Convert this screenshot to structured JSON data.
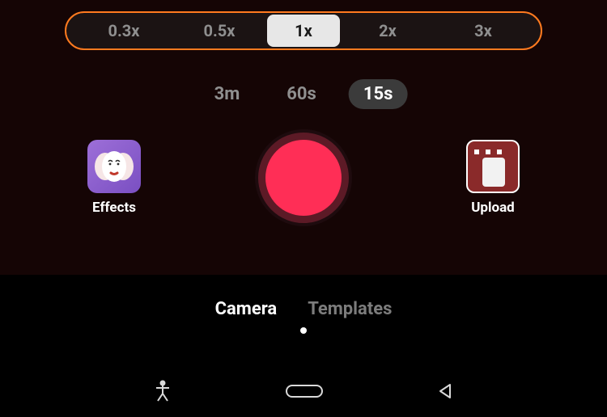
{
  "speed": {
    "options": [
      "0.3x",
      "0.5x",
      "1x",
      "2x",
      "3x"
    ],
    "activeIndex": 2
  },
  "duration": {
    "options": [
      "3m",
      "60s",
      "15s"
    ],
    "activeIndex": 2
  },
  "actions": {
    "effectsLabel": "Effects",
    "uploadLabel": "Upload"
  },
  "modes": {
    "options": [
      "Camera",
      "Templates"
    ],
    "activeIndex": 0
  }
}
